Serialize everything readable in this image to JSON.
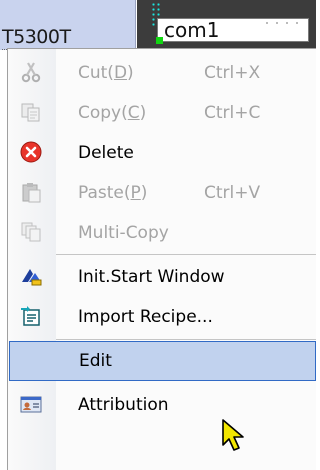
{
  "tabs": {
    "device_label": "T5300T",
    "port_label": "com1"
  },
  "menu": {
    "items": [
      {
        "label": "Cut(",
        "mnemonic": "D",
        "tail": ")",
        "shortcut": "Ctrl+X",
        "enabled": false,
        "icon": "scissors-icon"
      },
      {
        "label": "Copy(",
        "mnemonic": "C",
        "tail": ")",
        "shortcut": "Ctrl+C",
        "enabled": false,
        "icon": "copy-icon"
      },
      {
        "label": "Delete",
        "shortcut": "",
        "enabled": true,
        "icon": "delete-icon"
      },
      {
        "label": "Paste(",
        "mnemonic": "P",
        "tail": ")",
        "shortcut": "Ctrl+V",
        "enabled": false,
        "icon": "paste-icon"
      },
      {
        "label": "Multi-Copy",
        "shortcut": "",
        "enabled": false,
        "icon": "multi-copy-icon"
      },
      {
        "label": "Init.Start Window",
        "shortcut": "",
        "enabled": true,
        "icon": "init-window-icon"
      },
      {
        "label": "Import Recipe...",
        "shortcut": "",
        "enabled": true,
        "icon": "import-recipe-icon"
      },
      {
        "label": "Edit",
        "shortcut": "",
        "enabled": true,
        "highlighted": true,
        "icon": ""
      },
      {
        "label": "Attribution",
        "shortcut": "",
        "enabled": true,
        "icon": "attribution-icon"
      }
    ]
  },
  "colors": {
    "highlight_bg": "#c1d2ee",
    "highlight_border": "#316ac5",
    "disabled_text": "#a4a4a4"
  }
}
